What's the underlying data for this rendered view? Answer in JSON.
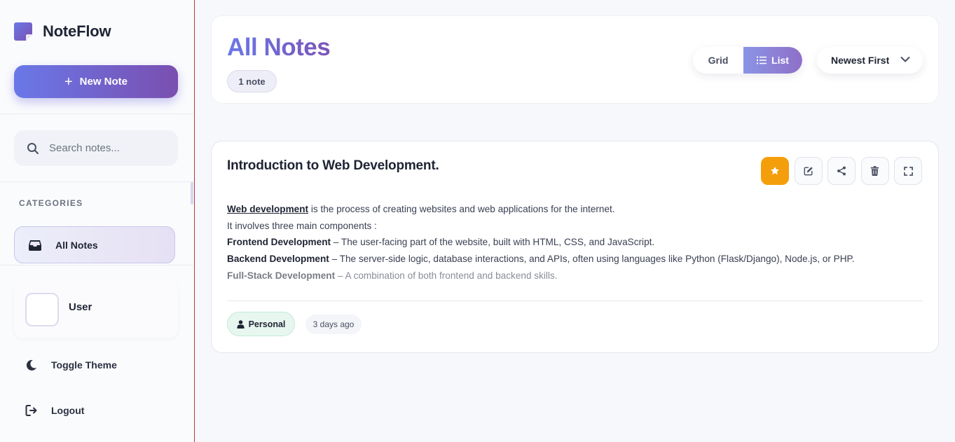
{
  "app": {
    "name": "NoteFlow"
  },
  "sidebar": {
    "new_note_label": "New Note",
    "search_placeholder": "Search notes...",
    "categories_title": "CATEGORIES",
    "categories": [
      {
        "label": "All Notes",
        "icon": "inbox-icon",
        "active": true
      }
    ],
    "user": {
      "name": "User"
    },
    "toggle_theme_label": "Toggle Theme",
    "logout_label": "Logout"
  },
  "header": {
    "title": "All Notes",
    "count_label": "1 note",
    "view_options": [
      "Grid",
      "List"
    ],
    "active_view": "List",
    "sort_label": "Newest First"
  },
  "note": {
    "title": "Introduction to Web Development.",
    "actions": [
      "star-icon",
      "edit-icon",
      "share-icon",
      "trash-icon",
      "expand-icon"
    ],
    "starred": true,
    "body": {
      "line1_link": "Web development",
      "line1_rest": " is the process of creating websites and web applications for the internet.",
      "line2": "It involves three main components :",
      "line3_bold": "Frontend Development",
      "line3_rest": " – The user-facing part of the website, built with HTML, CSS, and JavaScript.",
      "line4_bold": "Backend Development",
      "line4_rest": " – The server-side logic, database interactions, and APIs, often using languages like Python (Flask/Django), Node.js, or PHP.",
      "line5_bold": "Full-Stack Development",
      "line5_rest": " – A combination of both frontend and backend skills."
    },
    "tag": "Personal",
    "date": "3 days ago"
  },
  "colors": {
    "accent_start": "#6a78e8",
    "accent_end": "#7a4fb0",
    "star": "#f59e0b",
    "sidebar_border": "#c0363a"
  }
}
